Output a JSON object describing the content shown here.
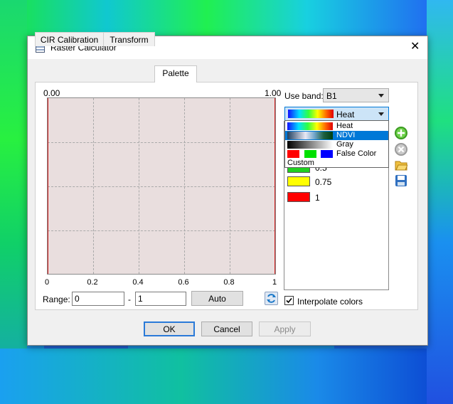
{
  "window": {
    "title": "Raster Calculator"
  },
  "tabs": [
    {
      "label": "CIR Calibration"
    },
    {
      "label": "Transform"
    },
    {
      "label": "Palette"
    }
  ],
  "active_tab": "Palette",
  "plot": {
    "top_left_label": "0.00",
    "top_right_label": "1.00",
    "x_ticks": [
      "0",
      "0.2",
      "0.4",
      "0.6",
      "0.8",
      "1"
    ]
  },
  "range": {
    "label": "Range:",
    "from": "0",
    "separator": "-",
    "to": "1",
    "auto_label": "Auto"
  },
  "use_band": {
    "label": "Use band:",
    "value": "B1"
  },
  "palette": {
    "selected": "Heat",
    "options": [
      {
        "label": "Heat"
      },
      {
        "label": "NDVI"
      },
      {
        "label": "Gray"
      },
      {
        "label": "False Color"
      },
      {
        "label": "Custom"
      }
    ]
  },
  "palette_entries": [
    {
      "value": "0.5",
      "color": "#20d020"
    },
    {
      "value": "0.75",
      "color": "#ffff00"
    },
    {
      "value": "1",
      "color": "#ff0000"
    }
  ],
  "interpolate": {
    "label": "Interpolate colors",
    "checked": true
  },
  "buttons": {
    "ok": "OK",
    "cancel": "Cancel",
    "apply": "Apply"
  },
  "colors": {
    "accent": "#0078d7",
    "plot_bg": "#e9dede",
    "curve": "#d42020"
  }
}
